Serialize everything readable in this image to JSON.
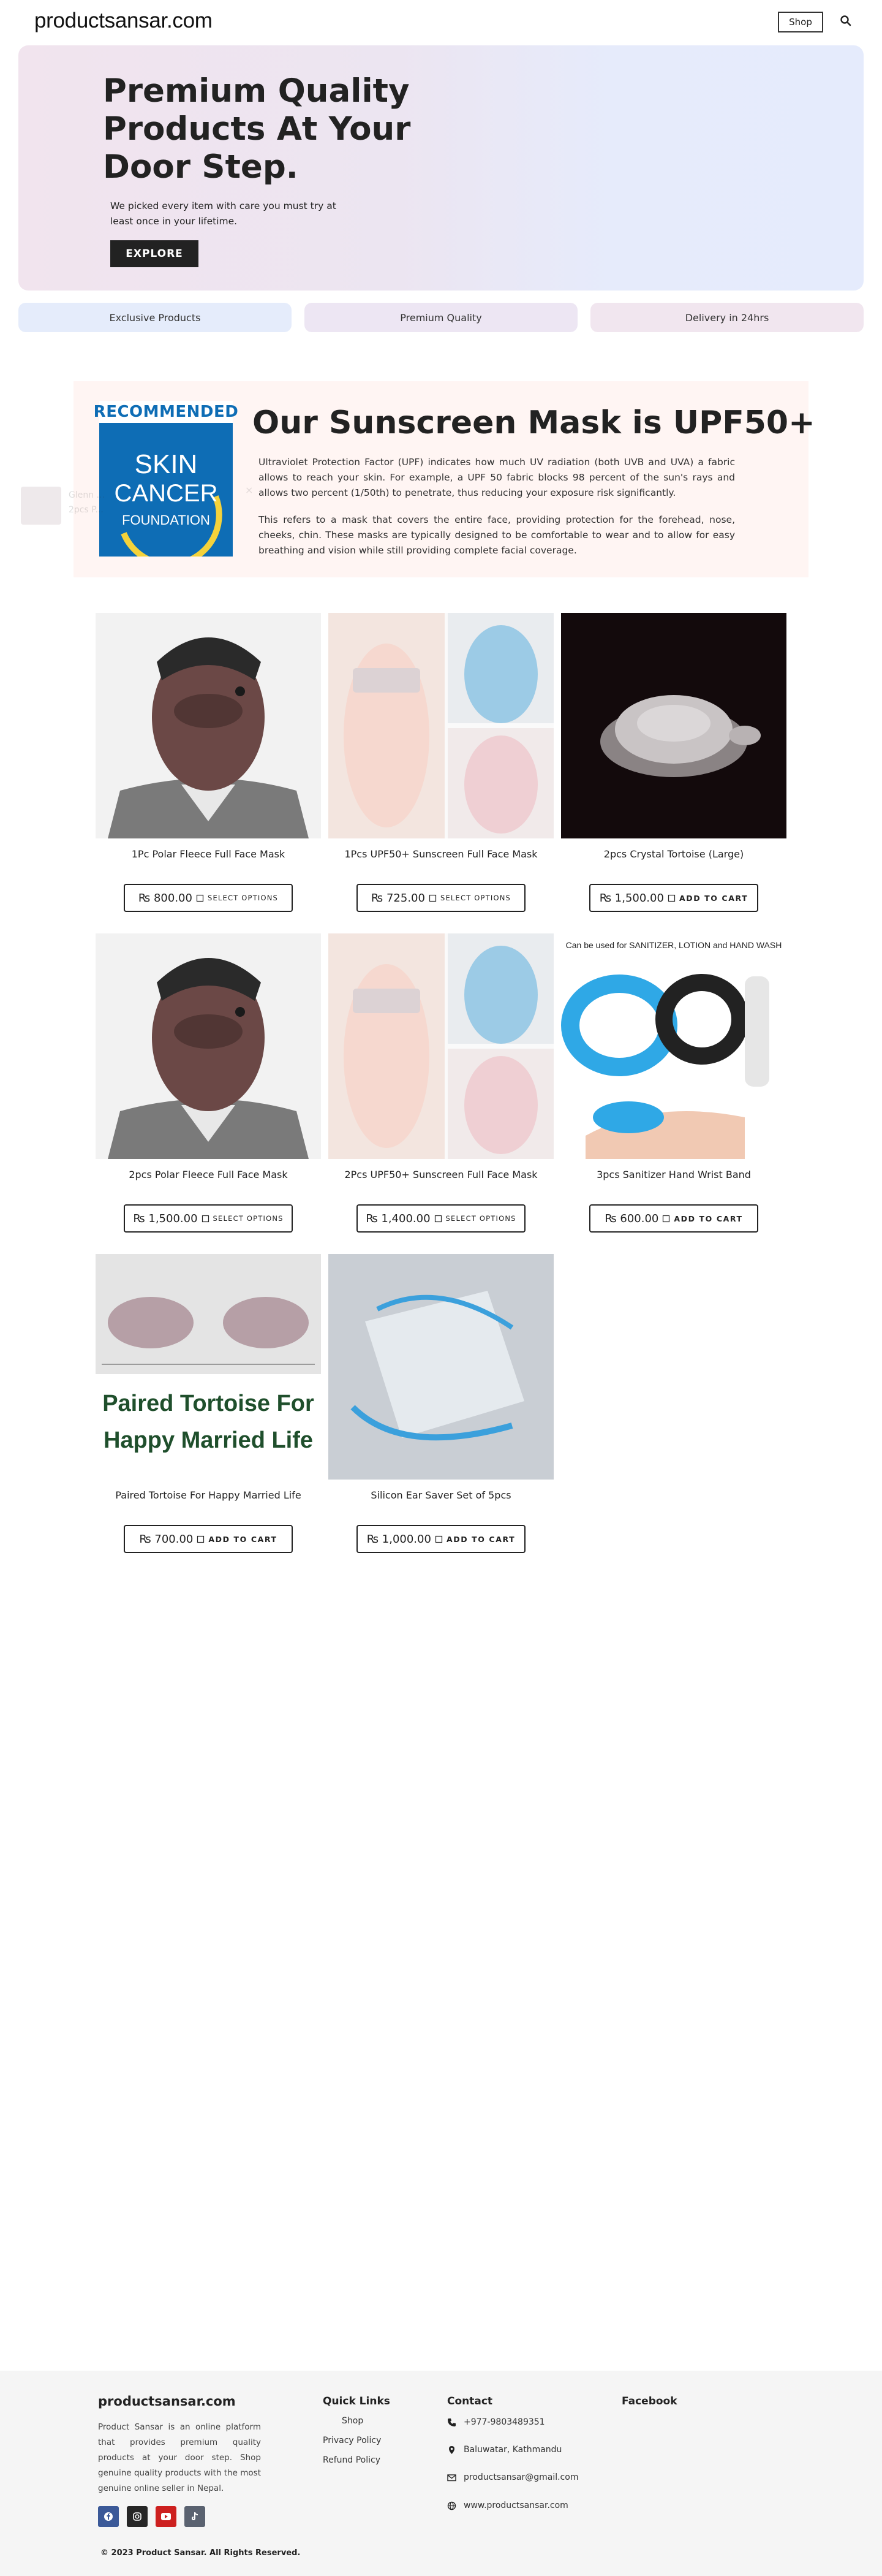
{
  "header": {
    "logo": "productsansar.com",
    "shop_label": "Shop"
  },
  "hero": {
    "title": "Premium Quality Products At Your Door Step.",
    "subtitle": "We picked every item with care you must try at least once in your lifetime.",
    "cta": "EXPLORE"
  },
  "features": [
    "Exclusive Products",
    "Premium Quality",
    "Delivery in 24hrs"
  ],
  "sunscreen": {
    "badge_top": "RECOMMENDED",
    "badge_line1": "SKIN",
    "badge_line2": "CANCER",
    "badge_line3": "FOUNDATION",
    "title": "Our Sunscreen Mask is UPF50+",
    "paragraph1": "Ultraviolet Protection Factor (UPF) indicates how much UV radiation (both UVB and UVA) a fabric allows to reach your skin. For example, a UPF 50 fabric blocks 98 percent of the sun's rays and allows two percent (1/50th) to penetrate, thus reducing your exposure risk significantly.",
    "paragraph2": "This refers to a mask that covers the entire face, providing protection for the forehead, nose, cheeks, chin. These masks are typically designed to be comfortable to wear and to allow for easy breathing and vision while still providing complete facial coverage."
  },
  "popup": {
    "line1": "Glenn ...",
    "line2": "2pcs P..."
  },
  "products": [
    {
      "name": "1Pc Polar Fleece Full Face Mask",
      "price": "₨ 800.00",
      "action": "SELECT OPTIONS"
    },
    {
      "name": "1Pcs UPF50+ Sunscreen Full Face Mask",
      "price": "₨ 725.00",
      "action": "SELECT OPTIONS"
    },
    {
      "name": "2pcs Crystal Tortoise (Large)",
      "price": "₨ 1,500.00",
      "action": "ADD TO CART"
    },
    {
      "name": "2pcs Polar Fleece Full Face Mask",
      "price": "₨ 1,500.00",
      "action": "SELECT OPTIONS"
    },
    {
      "name": "2Pcs UPF50+ Sunscreen Full Face Mask",
      "price": "₨ 1,400.00",
      "action": "SELECT OPTIONS"
    },
    {
      "name": "3pcs Sanitizer Hand Wrist Band",
      "price": "₨ 600.00",
      "action": "ADD TO CART",
      "image_caption": "Can be used for SANITIZER, LOTION and HAND WASH"
    },
    {
      "name": "Paired Tortoise For Happy Married Life",
      "price": "₨ 700.00",
      "action": "ADD TO CART",
      "image_caption_line1": "Paired Tortoise For",
      "image_caption_line2": "Happy Married Life"
    },
    {
      "name": "Silicon Ear Saver Set of 5pcs",
      "price": "₨ 1,000.00",
      "action": "ADD TO CART"
    }
  ],
  "footer": {
    "brand": "productsansar.com",
    "about": "Product Sansar is an online platform that provides premium quality products at your door step. Shop genuine quality products with the most genuine online seller in Nepal.",
    "quick_links_heading": "Quick Links",
    "quick_links": [
      "Shop",
      "Privacy Policy",
      "Refund Policy"
    ],
    "contact_heading": "Contact",
    "contact": {
      "phone": "+977-9803489351",
      "address": "Baluwatar, Kathmandu",
      "email": "productsansar@gmail.com",
      "website": "www.productsansar.com"
    },
    "facebook_heading": "Facebook",
    "copyright": "© 2023 Product Sansar. All Rights Reserved."
  },
  "colors": {
    "primary_dark": "#222222",
    "badge_blue": "#0e6db5",
    "facebook": "#3b5998",
    "youtube": "#cd201f"
  }
}
